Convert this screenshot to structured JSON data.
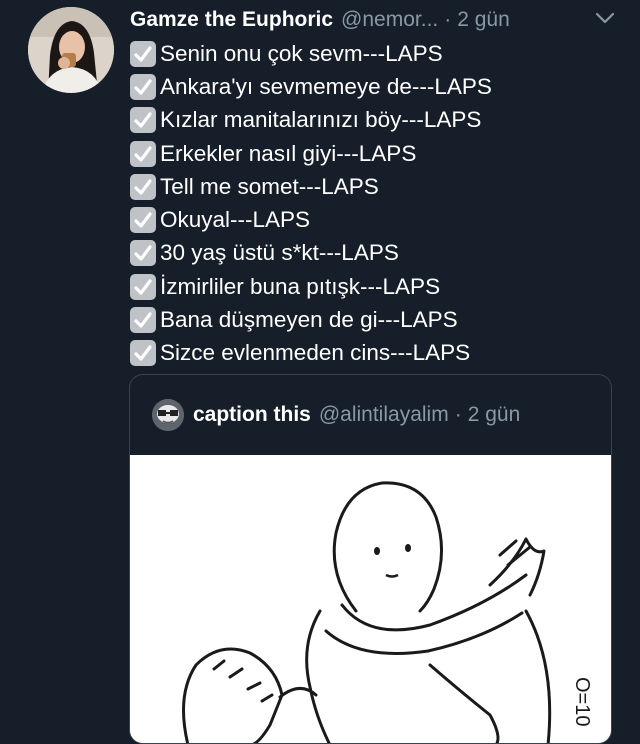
{
  "tweet": {
    "display_name": "Gamze the Euphoric",
    "handle": "@nemor...",
    "separator": "·",
    "time": "2 gün",
    "lines": [
      "Senin onu çok sevm---LAPS",
      "Ankara'yı sevmemeye de---LAPS",
      "Kızlar manitalarınızı böy---LAPS",
      "Erkekler nasıl giyi---LAPS",
      "Tell me somet---LAPS",
      "Okuyal---LAPS",
      "30 yaş üstü s*kt---LAPS",
      "İzmirliler buna pıtışk---LAPS",
      "Bana düşmeyen de gi---LAPS",
      "Sizce evlenmeden cins---LAPS"
    ]
  },
  "quoted": {
    "display_name": "caption this",
    "handle": "@alintilayalim",
    "separator": "·",
    "time": "2 gün",
    "image_text": "O=10"
  },
  "icons": {
    "check": "check-mark-icon",
    "caret": "chevron-down-icon"
  },
  "colors": {
    "background": "#151e29",
    "secondary_text": "#8899a6",
    "border": "#38444d",
    "check_box": "#bfc3c7"
  }
}
